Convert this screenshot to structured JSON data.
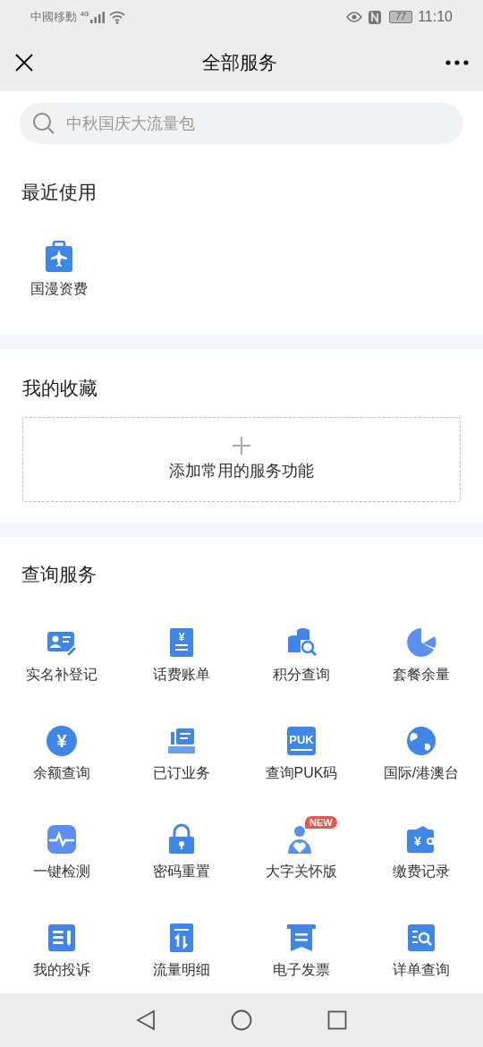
{
  "status_bar": {
    "carrier": "中國移動",
    "network": "4G",
    "battery": "77",
    "time": "11:10"
  },
  "header": {
    "title": "全部服务"
  },
  "search": {
    "placeholder": "中秋国庆大流量包"
  },
  "recent": {
    "title": "最近使用",
    "items": [
      {
        "label": "国漫资费"
      }
    ]
  },
  "favorites": {
    "title": "我的收藏",
    "add_label": "添加常用的服务功能"
  },
  "query": {
    "title": "查询服务",
    "items": [
      {
        "label": "实名补登记"
      },
      {
        "label": "话费账单",
        "icon_text": "¥"
      },
      {
        "label": "积分查询"
      },
      {
        "label": "套餐余量"
      },
      {
        "label": "余额查询",
        "icon_text": "¥"
      },
      {
        "label": "已订业务"
      },
      {
        "label": "查询PUK码",
        "icon_text": "PUK"
      },
      {
        "label": "国际/港澳台"
      },
      {
        "label": "一键检测"
      },
      {
        "label": "密码重置"
      },
      {
        "label": "大字关怀版",
        "badge": "NEW"
      },
      {
        "label": "缴费记录",
        "icon_text": "¥"
      },
      {
        "label": "我的投诉"
      },
      {
        "label": "流量明细"
      },
      {
        "label": "电子发票"
      },
      {
        "label": "详单查询"
      }
    ]
  }
}
